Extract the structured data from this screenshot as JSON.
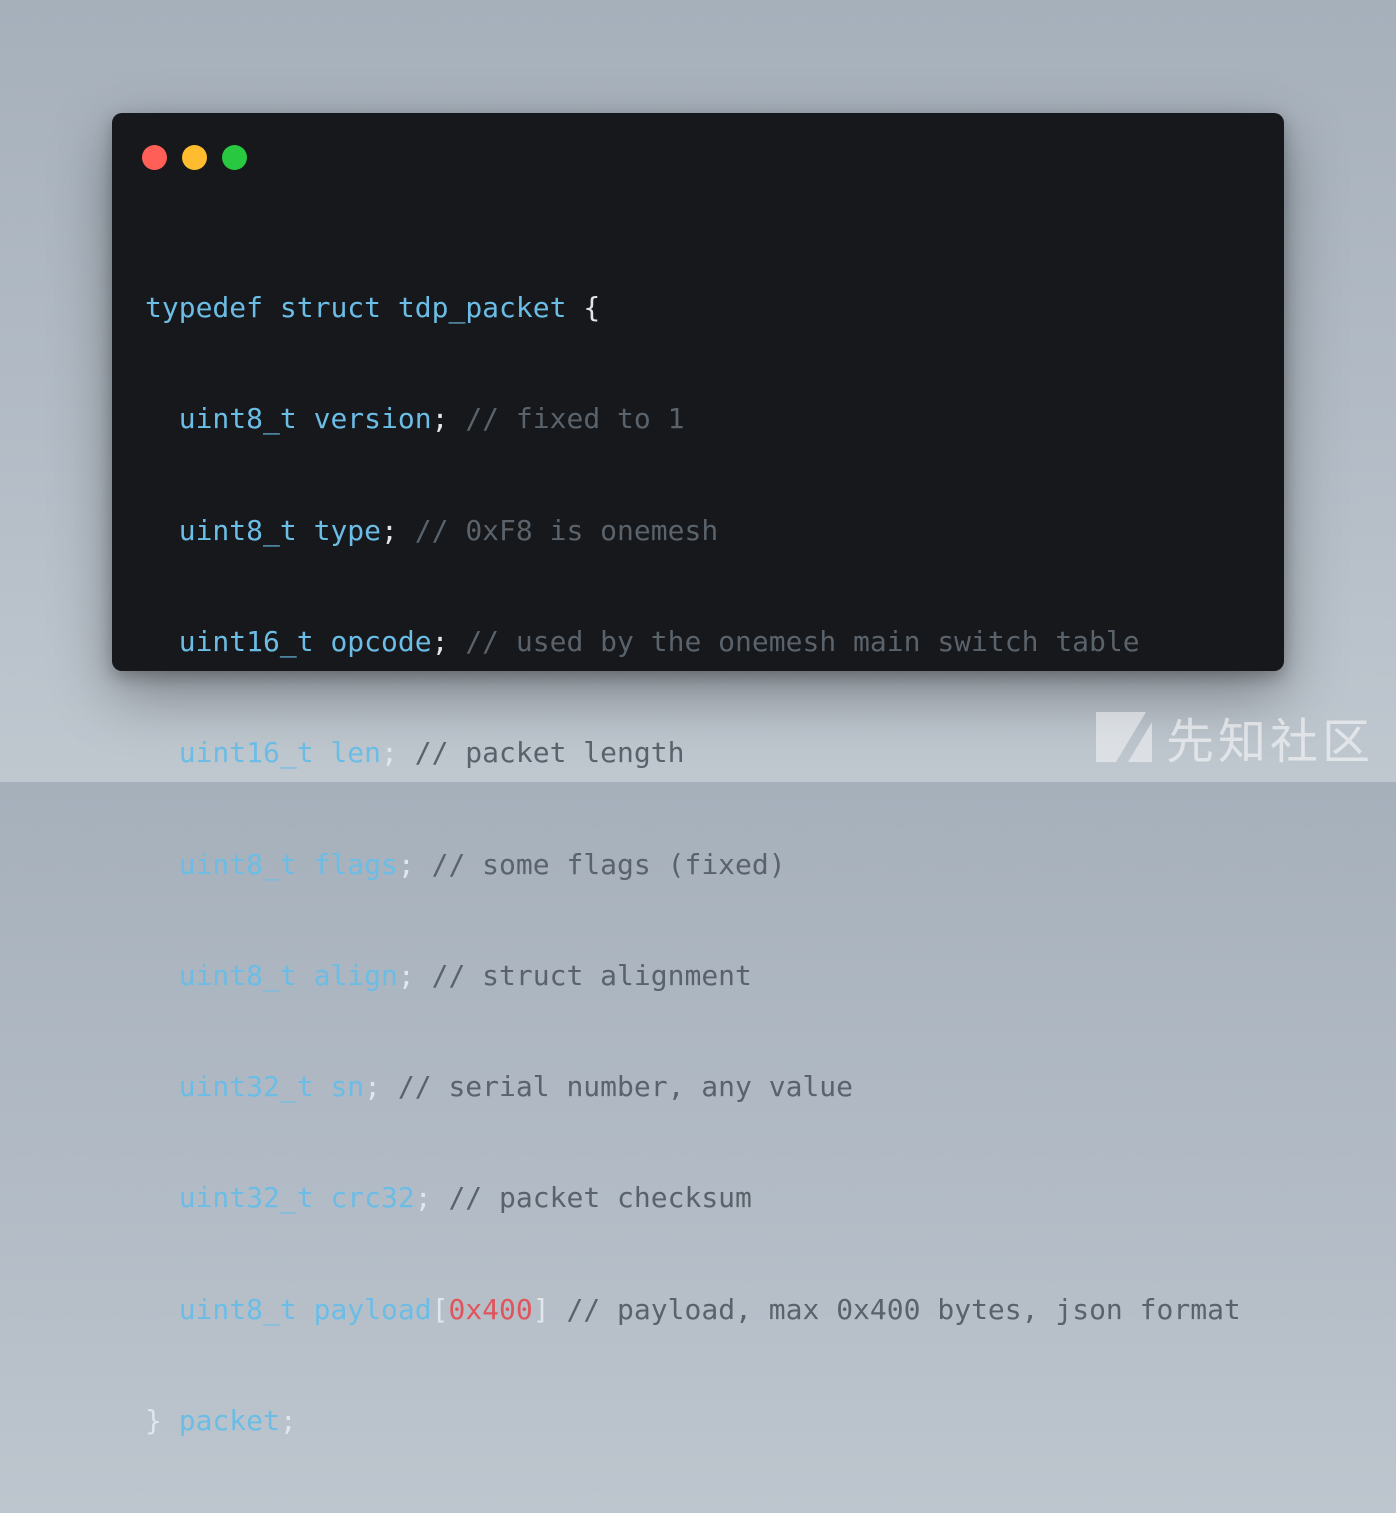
{
  "window": {
    "traffic_lights": {
      "close_color": "#ff5f57",
      "minimize_color": "#febc2e",
      "maximize_color": "#28c840"
    }
  },
  "colors": {
    "background": "#b3bcc6",
    "editor_bg": "#16181b",
    "keyword": "#6bbde6",
    "comment": "#5a626b",
    "number": "#e0555b",
    "punctuation": "#e0e6ec"
  },
  "code": {
    "l1": {
      "kw1": "typedef",
      "kw2": "struct",
      "name": "tdp_packet",
      "brace": "{"
    },
    "l2": {
      "indent": "  ",
      "type": "uint8_t",
      "field": "version",
      "semi": ";",
      "comment": "// fixed to 1"
    },
    "l3": {
      "indent": "  ",
      "type": "uint8_t",
      "field": "type",
      "semi": ";",
      "comment": "// 0xF8 is onemesh"
    },
    "l4": {
      "indent": "  ",
      "type": "uint16_t",
      "field": "opcode",
      "semi": ";",
      "comment": "// used by the onemesh main switch table"
    },
    "l5": {
      "indent": "  ",
      "type": "uint16_t",
      "field": "len",
      "semi": ";",
      "comment": "// packet length"
    },
    "l6": {
      "indent": "  ",
      "type": "uint8_t",
      "field": "flags",
      "semi": ";",
      "comment": "// some flags (fixed)"
    },
    "l7": {
      "indent": "  ",
      "type": "uint8_t",
      "field": "align",
      "semi": ";",
      "comment": "// struct alignment"
    },
    "l8": {
      "indent": "  ",
      "type": "uint32_t",
      "field": "sn",
      "semi": ";",
      "comment": "// serial number, any value"
    },
    "l9": {
      "indent": "  ",
      "type": "uint32_t",
      "field": "crc32",
      "semi": ";",
      "comment": "// packet checksum"
    },
    "l10": {
      "indent": "  ",
      "type": "uint8_t",
      "field": "payload",
      "open": "[",
      "size": "0x400",
      "close": "]",
      "comment": "// payload, max 0x400 bytes, json format"
    },
    "l11": {
      "brace": "}",
      "name": "packet",
      "semi": ";"
    }
  },
  "watermark": {
    "text": "先知社区",
    "icon": "xianzhi-logo-icon"
  }
}
